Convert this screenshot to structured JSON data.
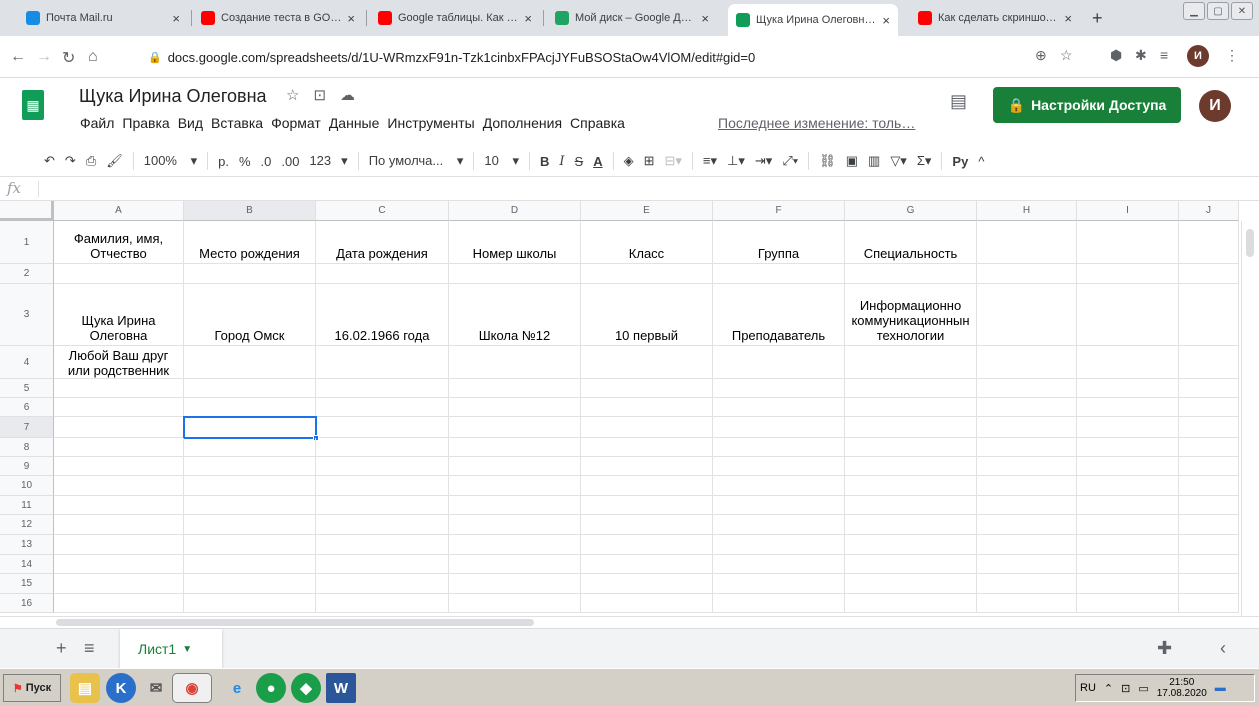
{
  "browser": {
    "tabs": [
      {
        "label": "Почта Mail.ru",
        "icon": "mail-icon",
        "color": "#168de2"
      },
      {
        "label": "Создание теста в GOOGLE",
        "icon": "youtube-icon",
        "color": "#ff0000"
      },
      {
        "label": "Google таблицы. Как созд",
        "icon": "youtube-icon",
        "color": "#ff0000"
      },
      {
        "label": "Мой диск – Google Диск",
        "icon": "drive-icon",
        "color": "#1fa463"
      },
      {
        "label": "Щука Ирина Олеговна - G",
        "icon": "sheets-icon",
        "color": "#0f9d58"
      },
      {
        "label": "Как сделать скриншот на",
        "icon": "youtube-icon",
        "color": "#ff0000"
      }
    ],
    "new_tab": "+",
    "url": "docs.google.com/spreadsheets/d/1U-WRmzxF91n-Tzk1cinbxFPAcjJYFuBSOStaOw4VlOM/edit#gid=0",
    "profile_initial": "И"
  },
  "doc": {
    "title": "Щука Ирина Олеговна",
    "menus": [
      "Файл",
      "Правка",
      "Вид",
      "Вставка",
      "Формат",
      "Данные",
      "Инструменты",
      "Дополнения",
      "Справка"
    ],
    "last_edit": "Последнее изменение: толь…",
    "share_label": "Настройки Доступа",
    "user_initial": "И"
  },
  "toolbar": {
    "zoom": "100%",
    "currency": "р.",
    "percent": "%",
    "dec_less": ".0",
    "dec_more": ".00",
    "format_more": "123",
    "font": "По умолча...",
    "font_size": "10",
    "bold": "B",
    "italic": "I",
    "strike": "S",
    "text_color": "A",
    "input_tools": "Ру"
  },
  "formula_bar": {
    "fx": "fx",
    "value": ""
  },
  "sheet": {
    "columns": [
      "A",
      "B",
      "C",
      "D",
      "E",
      "F",
      "G",
      "H",
      "I",
      "J"
    ],
    "rows": [
      {
        "num": "1",
        "cells": [
          "Фамилия, имя, Отчество",
          "Место рождения",
          "Дата рождения",
          "Номер школы",
          "Класс",
          "Группа",
          "Специальность",
          "",
          "",
          ""
        ]
      },
      {
        "num": "2",
        "cells": [
          "",
          "",
          "",
          "",
          "",
          "",
          "",
          "",
          "",
          ""
        ]
      },
      {
        "num": "3",
        "cells": [
          "Щука Ирина Олеговна",
          "Город Омск",
          "16.02.1966 года",
          "Школа №12",
          "10 первый",
          "Преподаватель",
          "Информационно коммуникационнын технологии",
          "",
          "",
          ""
        ]
      },
      {
        "num": "4",
        "cells": [
          "Любой Ваш друг или родственник",
          "",
          "",
          "",
          "",
          "",
          "",
          "",
          "",
          ""
        ]
      },
      {
        "num": "5",
        "cells": [
          "",
          "",
          "",
          "",
          "",
          "",
          "",
          "",
          "",
          ""
        ]
      },
      {
        "num": "6",
        "cells": [
          "",
          "",
          "",
          "",
          "",
          "",
          "",
          "",
          "",
          ""
        ]
      },
      {
        "num": "7",
        "cells": [
          "",
          "",
          "",
          "",
          "",
          "",
          "",
          "",
          "",
          ""
        ]
      },
      {
        "num": "8",
        "cells": [
          "",
          "",
          "",
          "",
          "",
          "",
          "",
          "",
          "",
          ""
        ]
      },
      {
        "num": "9",
        "cells": [
          "",
          "",
          "",
          "",
          "",
          "",
          "",
          "",
          "",
          ""
        ]
      },
      {
        "num": "10",
        "cells": [
          "",
          "",
          "",
          "",
          "",
          "",
          "",
          "",
          "",
          ""
        ]
      },
      {
        "num": "11",
        "cells": [
          "",
          "",
          "",
          "",
          "",
          "",
          "",
          "",
          "",
          ""
        ]
      },
      {
        "num": "12",
        "cells": [
          "",
          "",
          "",
          "",
          "",
          "",
          "",
          "",
          "",
          ""
        ]
      },
      {
        "num": "13",
        "cells": [
          "",
          "",
          "",
          "",
          "",
          "",
          "",
          "",
          "",
          ""
        ]
      },
      {
        "num": "14",
        "cells": [
          "",
          "",
          "",
          "",
          "",
          "",
          "",
          "",
          "",
          ""
        ]
      },
      {
        "num": "15",
        "cells": [
          "",
          "",
          "",
          "",
          "",
          "",
          "",
          "",
          "",
          ""
        ]
      },
      {
        "num": "16",
        "cells": [
          "",
          "",
          "",
          "",
          "",
          "",
          "",
          "",
          "",
          ""
        ]
      }
    ],
    "selected_cell": "B7",
    "sheet_tab": "Лист1"
  },
  "taskbar": {
    "start_label": "Пуск",
    "language": "RU",
    "time": "21:50",
    "date": "17.08.2020"
  }
}
